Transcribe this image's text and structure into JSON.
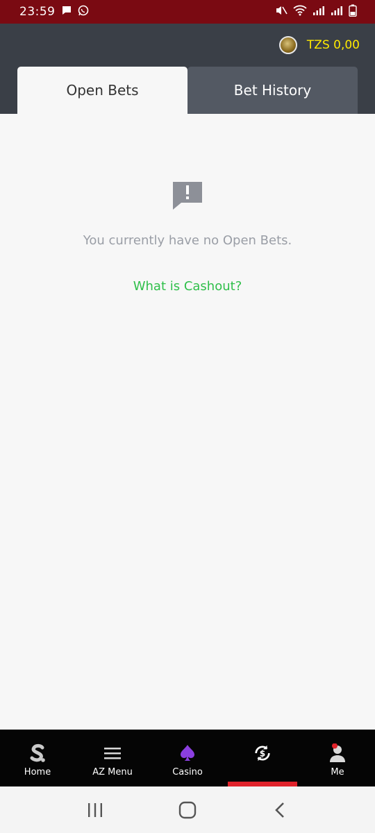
{
  "status_bar": {
    "time": "23:59",
    "icons": [
      "message-icon",
      "whatsapp-icon",
      "mute-icon",
      "wifi-icon",
      "signal-icon",
      "signal-icon",
      "battery-icon"
    ]
  },
  "header": {
    "balance": "TZS 0,00",
    "balance_color": "#ffea00"
  },
  "tabs": [
    {
      "label": "Open Bets",
      "active": true
    },
    {
      "label": "Bet History",
      "active": false
    }
  ],
  "empty_state": {
    "icon": "alert-message-icon",
    "message": "You currently have no Open Bets.",
    "link": "What is Cashout?",
    "link_color": "#2fbf4a"
  },
  "bottom_nav": [
    {
      "label": "Home",
      "icon": "home-s-icon"
    },
    {
      "label": "AZ Menu",
      "icon": "hamburger-icon"
    },
    {
      "label": "Casino",
      "icon": "spade-icon"
    },
    {
      "label": "",
      "icon": "cashout-icon",
      "active": true
    },
    {
      "label": "Me",
      "icon": "user-icon"
    }
  ],
  "accent_color": "#e0232b"
}
